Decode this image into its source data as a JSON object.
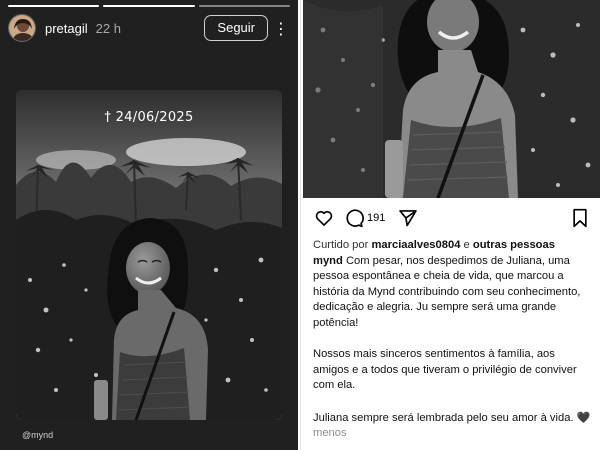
{
  "story": {
    "username": "pretagil",
    "time": "22 h",
    "follow_label": "Seguir",
    "more_icon": "more-vertical-icon",
    "date_text": "† 24/06/2025",
    "watermark": "@mynd",
    "progress_segments": 3,
    "progress_complete": 2
  },
  "post": {
    "comment_count": "191",
    "icons": [
      "heart-icon",
      "comment-icon",
      "share-icon",
      "bookmark-icon"
    ],
    "liked_prefix": "Curtido por",
    "liked_user": "marciaalves0804",
    "liked_and": "e",
    "liked_others": "outras pessoas",
    "caption_user": "mynd",
    "caption_p1": "Com pesar, nos despedimos de Juliana, uma pessoa espontânea e cheia de vida, que marcou a história da Mynd contribuindo com seu conhecimento, dedicação e alegria. Ju sempre será uma grande potência!",
    "caption_p2": "Nossos mais sinceros sentimentos à família, aos amigos e a todos que tiveram o privilégio de conviver com ela.",
    "caption_p3": "Juliana sempre será lembrada pelo seu amor à vida.",
    "heart_emoji": "🖤",
    "less_label": "menos"
  },
  "colors": {
    "story_bg": "#202020",
    "photo_dark": "#1c1c1c",
    "photo_sky": "#d8d8d8",
    "text": "#111111",
    "muted": "#8e8e8e"
  }
}
